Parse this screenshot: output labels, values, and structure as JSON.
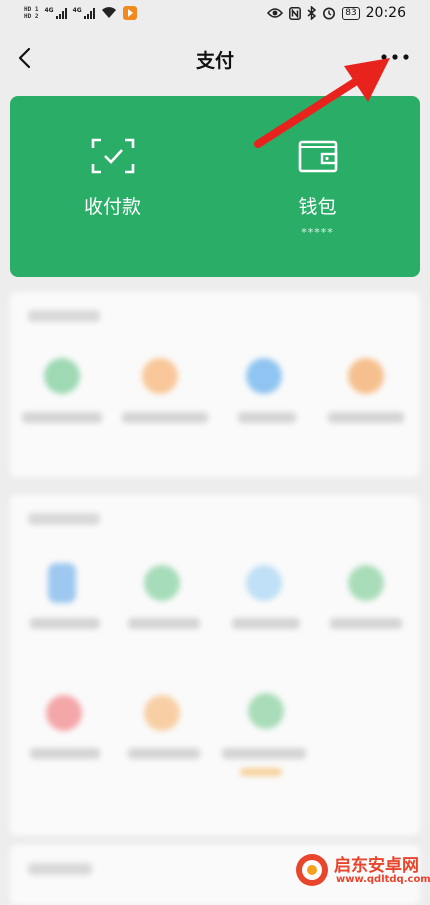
{
  "status_bar": {
    "hd1": "HD 1",
    "hd2": "HD 2",
    "net1": "4G",
    "net2": "4G",
    "battery": "83",
    "time": "20:26"
  },
  "header": {
    "title": "支付",
    "back_icon": "chevron-left-icon",
    "more_icon": "more-dots-icon"
  },
  "wallet_card": {
    "background": "#2aae67",
    "items": [
      {
        "label": "收付款",
        "icon": "scan-check-icon"
      },
      {
        "label": "钱包",
        "sub": "*****",
        "icon": "wallet-icon"
      }
    ]
  },
  "annotation": {
    "arrow_color": "#e8231d"
  },
  "watermark": {
    "name": "启东安卓网",
    "url": "www.qdltdq.com"
  }
}
